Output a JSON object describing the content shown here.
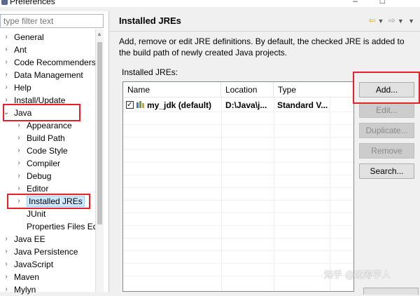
{
  "window": {
    "title": "Preferences",
    "controls": [
      "–",
      "□"
    ]
  },
  "filter": {
    "placeholder": "type filter text"
  },
  "tree": [
    {
      "label": "General",
      "expandable": true,
      "level": 0
    },
    {
      "label": "Ant",
      "expandable": true,
      "level": 0
    },
    {
      "label": "Code Recommenders",
      "expandable": true,
      "level": 0
    },
    {
      "label": "Data Management",
      "expandable": true,
      "level": 0
    },
    {
      "label": "Help",
      "expandable": true,
      "level": 0
    },
    {
      "label": "Install/Update",
      "expandable": true,
      "level": 0
    },
    {
      "label": "Java",
      "expandable": true,
      "expanded": true,
      "level": 0
    },
    {
      "label": "Appearance",
      "expandable": true,
      "level": 1
    },
    {
      "label": "Build Path",
      "expandable": true,
      "level": 1
    },
    {
      "label": "Code Style",
      "expandable": true,
      "level": 1
    },
    {
      "label": "Compiler",
      "expandable": true,
      "level": 1
    },
    {
      "label": "Debug",
      "expandable": true,
      "level": 1
    },
    {
      "label": "Editor",
      "expandable": true,
      "level": 1
    },
    {
      "label": "Installed JREs",
      "expandable": true,
      "level": 1,
      "selected": true
    },
    {
      "label": "JUnit",
      "expandable": false,
      "level": 1
    },
    {
      "label": "Properties Files Ed",
      "expandable": false,
      "level": 1
    },
    {
      "label": "Java EE",
      "expandable": true,
      "level": 0
    },
    {
      "label": "Java Persistence",
      "expandable": true,
      "level": 0
    },
    {
      "label": "JavaScript",
      "expandable": true,
      "level": 0
    },
    {
      "label": "Maven",
      "expandable": true,
      "level": 0
    },
    {
      "label": "Mylyn",
      "expandable": true,
      "level": 0
    }
  ],
  "page": {
    "title": "Installed JREs",
    "description": "Add, remove or edit JRE definitions. By default, the checked JRE is added to the build path of newly created Java projects.",
    "section_label": "Installed JREs:",
    "nav": {
      "back_icon": "back-arrow-icon",
      "forward_icon": "forward-arrow-icon"
    }
  },
  "table": {
    "columns": [
      "Name",
      "Location",
      "Type"
    ],
    "rows": [
      {
        "checked": true,
        "name": "my_jdk (default)",
        "location": "D:\\Java\\j...",
        "type": "Standard V..."
      }
    ]
  },
  "buttons": {
    "add": "Add...",
    "edit": "Edit...",
    "duplicate": "Duplicate...",
    "remove": "Remove",
    "search": "Search..."
  },
  "watermark": "知乎 @运筹学人",
  "colors": {
    "highlight": "#e8202a",
    "selection": "#cde8ff",
    "back_arrow": "#d9a13a"
  }
}
